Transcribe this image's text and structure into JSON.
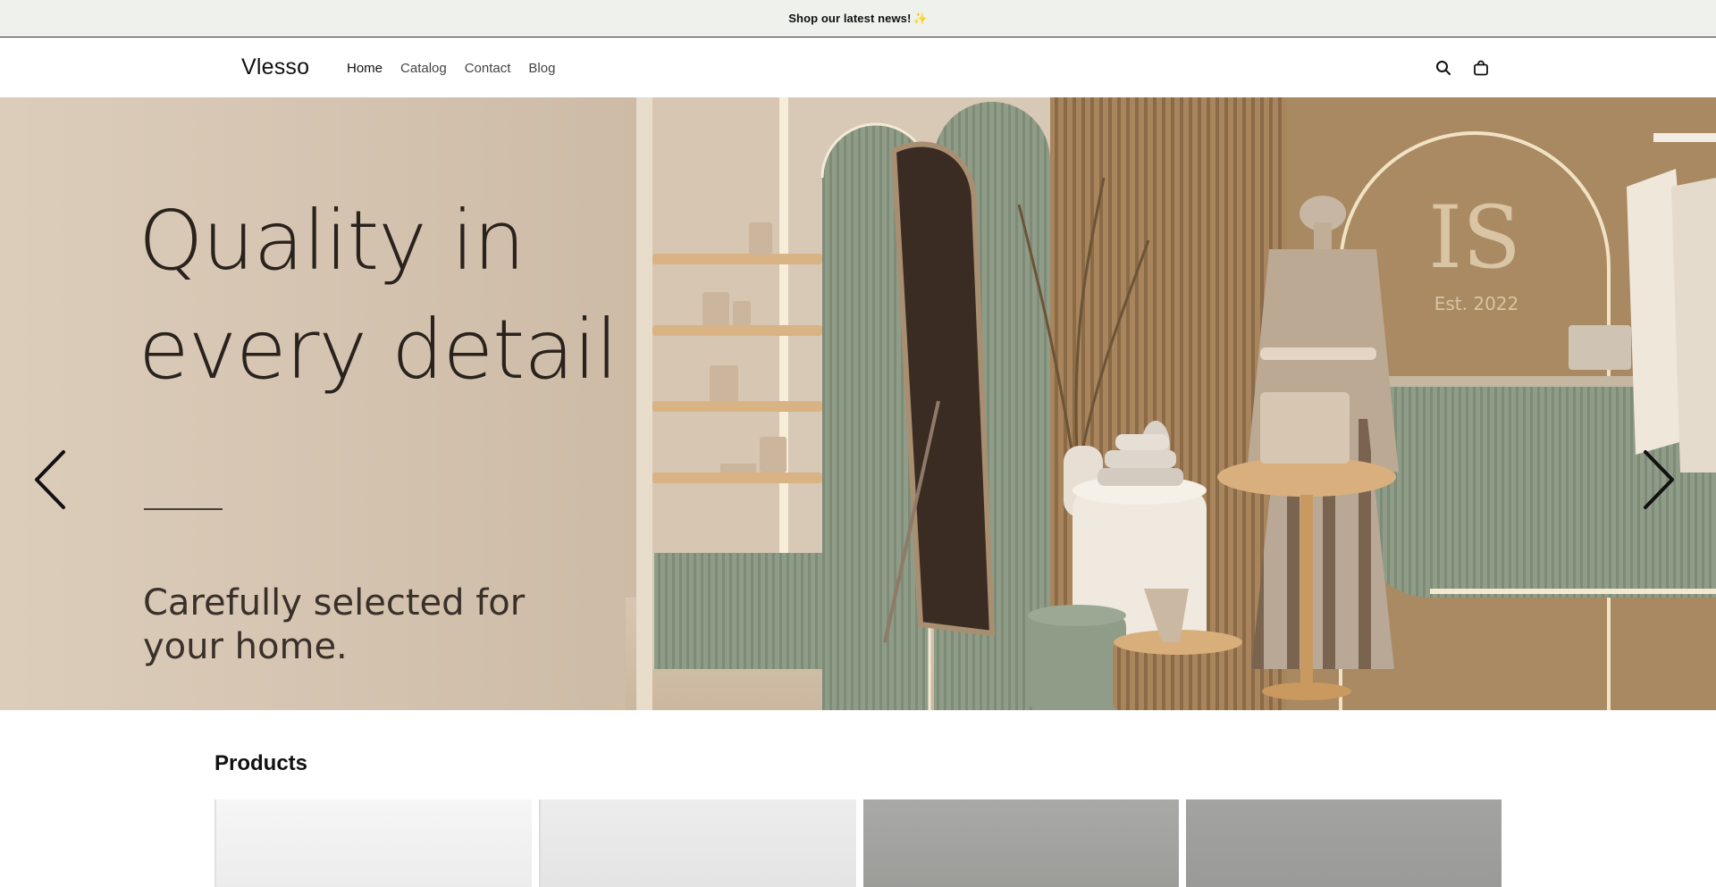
{
  "announcement": {
    "text": "Shop our latest news!",
    "emoji": "✨"
  },
  "header": {
    "logo": "Vlesso",
    "nav": [
      {
        "label": "Home",
        "active": true
      },
      {
        "label": "Catalog",
        "active": false
      },
      {
        "label": "Contact",
        "active": false
      },
      {
        "label": "Blog",
        "active": false
      }
    ],
    "icons": [
      "search-icon",
      "cart-icon"
    ]
  },
  "hero": {
    "title_line1": "Quality in",
    "title_line2": "every detail",
    "subtitle": "Carefully selected for your home.",
    "sign_monogram": "IS",
    "sign_est": "Est. 2022",
    "prev_icon": "chevron-left-icon",
    "next_icon": "chevron-right-icon"
  },
  "products": {
    "heading": "Products",
    "cards": [
      {
        "name": "product-card-1"
      },
      {
        "name": "product-card-2"
      },
      {
        "name": "product-card-3"
      },
      {
        "name": "product-card-4"
      }
    ]
  },
  "colors": {
    "announce_bg": "#eff1ec",
    "hero_wall": "#d8c8b6",
    "sage": "#8c9a86",
    "wood": "#c7935d"
  }
}
